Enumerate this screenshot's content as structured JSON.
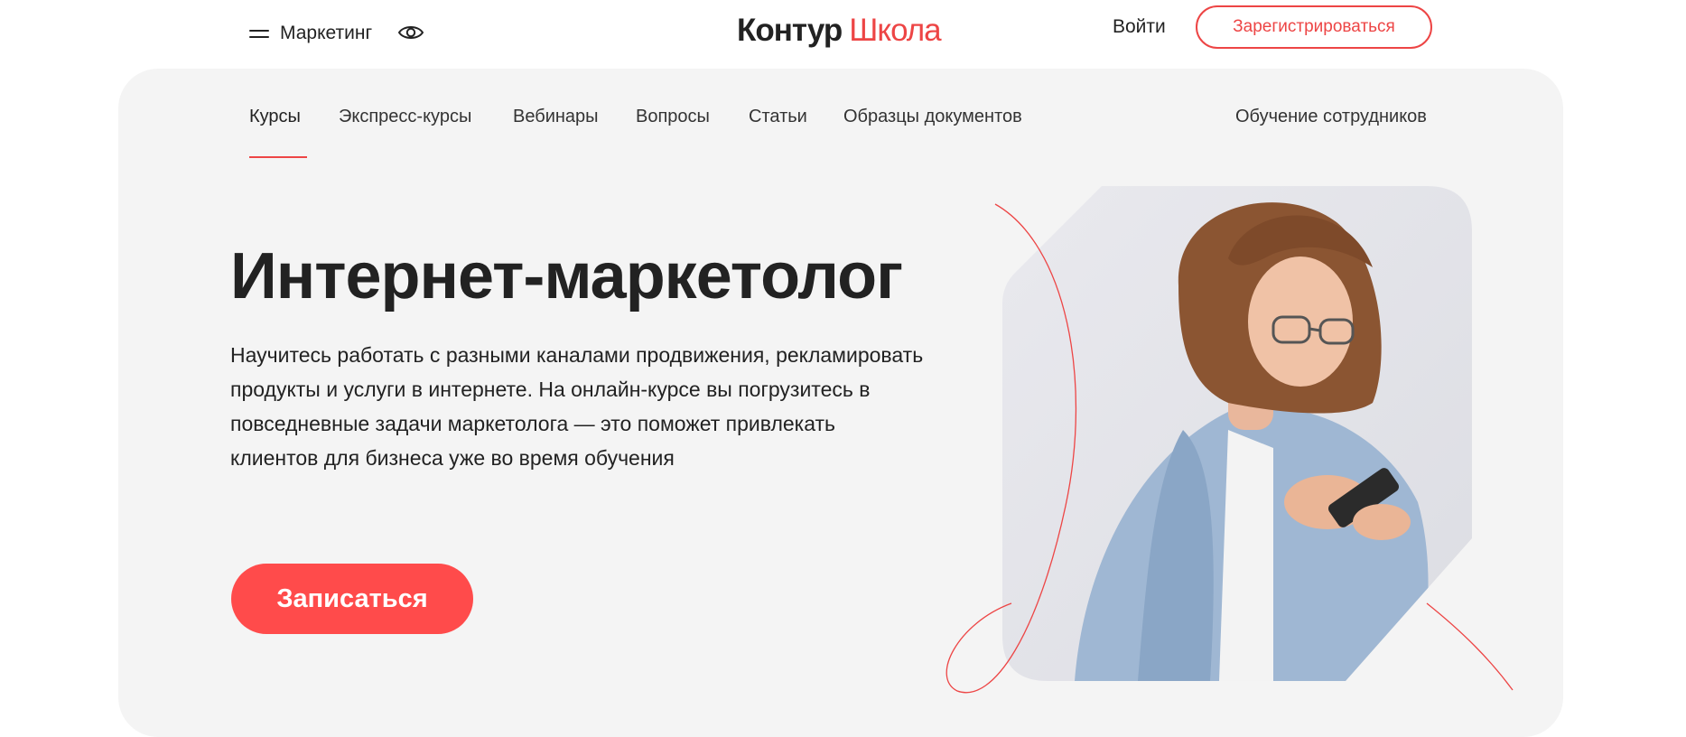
{
  "header": {
    "menu_label": "Маркетинг",
    "logo_brand": "Контур",
    "logo_school": "Школа",
    "login_label": "Войти",
    "register_label": "Зарегистрироваться"
  },
  "nav": {
    "items": [
      {
        "label": "Курсы",
        "active": true
      },
      {
        "label": "Экспресс-курсы"
      },
      {
        "label": "Вебинары"
      },
      {
        "label": "Вопросы"
      },
      {
        "label": "Статьи"
      },
      {
        "label": "Образцы документов"
      }
    ],
    "right_label": "Обучение сотрудников"
  },
  "hero": {
    "title": "Интернет-маркетолог",
    "description": "Научитесь работать с разными каналами продвижения, рекламировать продукты и услуги в интернете. На онлайн-курсе вы погрузитесь в повседневные задачи маркетолога — это поможет привлекать клиентов для бизнеса уже во время обучения",
    "cta_label": "Записаться"
  },
  "colors": {
    "accent": "#ed4545",
    "button": "#ff4b4b",
    "panel_bg": "#f4f4f4",
    "text": "#222222"
  },
  "icons": {
    "menu": "hamburger-icon",
    "accessibility": "eye-icon"
  }
}
